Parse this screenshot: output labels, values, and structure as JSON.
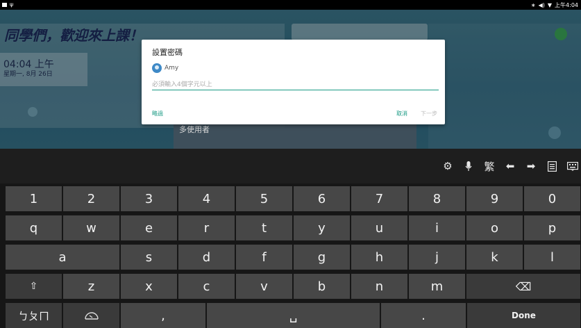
{
  "status_bar": {
    "time": "上午4:04",
    "icons": [
      "bluetooth-icon",
      "volume-icon",
      "wifi-icon"
    ]
  },
  "background": {
    "welcome": "同學們，歡迎來上課！",
    "clock_time": "04:04 上午",
    "clock_date": "星期一, 8月 26日",
    "multi_user": "多使用者"
  },
  "dialog": {
    "title": "設置密碼",
    "user_name": "Amy",
    "password_placeholder": "必須輸入4個字元以上",
    "password_value": "",
    "skip_label": "略過",
    "cancel_label": "取消",
    "next_label": "下一步"
  },
  "toolbar": {
    "icons": [
      "gear-icon",
      "microphone-icon",
      "traditional-chinese-icon",
      "arrow-left-icon",
      "arrow-right-icon",
      "clipboard-icon",
      "keyboard-icon"
    ],
    "traditional_label": "繁"
  },
  "keyboard": {
    "row1": [
      "1",
      "2",
      "3",
      "4",
      "5",
      "6",
      "7",
      "8",
      "9",
      "0"
    ],
    "row2": [
      "q",
      "w",
      "e",
      "r",
      "t",
      "y",
      "u",
      "i",
      "o",
      "p"
    ],
    "row3": [
      "a",
      "s",
      "d",
      "f",
      "g",
      "h",
      "j",
      "k",
      "l"
    ],
    "row4": [
      "z",
      "x",
      "c",
      "v",
      "b",
      "n",
      "m"
    ],
    "shift_glyph": "⇧",
    "backspace_glyph": "⌫",
    "lang_label": "ㄅㄆㄇ",
    "comma_label": ",",
    "space_label": "␣",
    "period_label": ".",
    "done_label": "Done",
    "colors": {
      "key": "#474747",
      "fn_key": "#3a3a3a",
      "accent": "#1a9a84"
    }
  }
}
